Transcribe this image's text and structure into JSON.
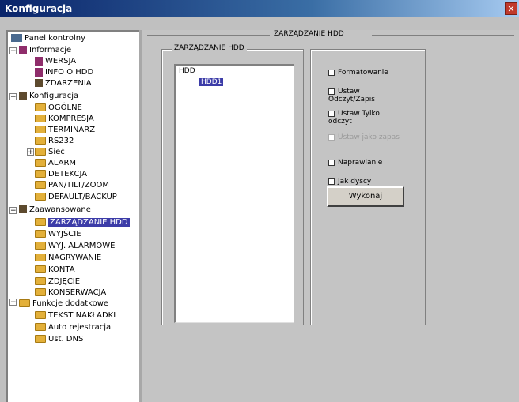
{
  "window": {
    "title": "Konfiguracja",
    "close_glyph": "✕"
  },
  "tree": {
    "items": [
      {
        "label": "Panel kontrolny",
        "icon": "panel-icon"
      },
      {
        "label": "Informacje",
        "icon": "doc-icon"
      },
      {
        "label": "WERSJA",
        "icon": "doc-icon"
      },
      {
        "label": "INFO O HDD",
        "icon": "doc-icon"
      },
      {
        "label": "ZDARZENIA",
        "icon": "tool-icon"
      },
      {
        "label": "Konfiguracja",
        "icon": "tool-icon"
      },
      {
        "label": "OGÓLNE",
        "icon": "folder-icon"
      },
      {
        "label": "KOMPRESJA",
        "icon": "folder-icon"
      },
      {
        "label": "TERMINARZ",
        "icon": "folder-icon"
      },
      {
        "label": "RS232",
        "icon": "folder-icon"
      },
      {
        "label": "Sieć",
        "icon": "folder-icon"
      },
      {
        "label": "ALARM",
        "icon": "folder-icon"
      },
      {
        "label": "DETEKCJA",
        "icon": "folder-icon"
      },
      {
        "label": "PAN/TILT/ZOOM",
        "icon": "folder-icon"
      },
      {
        "label": "DEFAULT/BACKUP",
        "icon": "folder-icon"
      },
      {
        "label": "Zaawansowane",
        "icon": "tool-icon"
      },
      {
        "label": "ZARZĄDZANIE HDD",
        "icon": "folder-icon"
      },
      {
        "label": "WYJŚCIE",
        "icon": "folder-icon"
      },
      {
        "label": "WYJ. ALARMOWE",
        "icon": "folder-icon"
      },
      {
        "label": "NAGRYWANIE",
        "icon": "folder-icon"
      },
      {
        "label": "KONTA",
        "icon": "folder-icon"
      },
      {
        "label": "ZDJĘCIE",
        "icon": "folder-icon"
      },
      {
        "label": "KONSERWACJA",
        "icon": "folder-icon"
      },
      {
        "label": "Funkcje dodatkowe",
        "icon": "folder-icon"
      },
      {
        "label": "TEKST NAKŁADKI",
        "icon": "folder-icon"
      },
      {
        "label": "Auto rejestracja",
        "icon": "folder-icon"
      },
      {
        "label": "Ust. DNS",
        "icon": "folder-icon"
      }
    ]
  },
  "main": {
    "section_title": "ZARZĄDZANIE HDD",
    "hdd_group_label": "ZARZĄDZANIE HDD",
    "hdd_root": "HDD",
    "hdd_child": "HDD1",
    "options": [
      {
        "label": "Formatowanie"
      },
      {
        "label": "Ustaw Odczyt/Zapis"
      },
      {
        "label": "Ustaw Tylko odczyt"
      },
      {
        "label": "Ustaw jako zapas"
      },
      {
        "label": "Naprawianie"
      },
      {
        "label": "Jak dyscy"
      }
    ],
    "apply_label": "Wykonaj"
  }
}
